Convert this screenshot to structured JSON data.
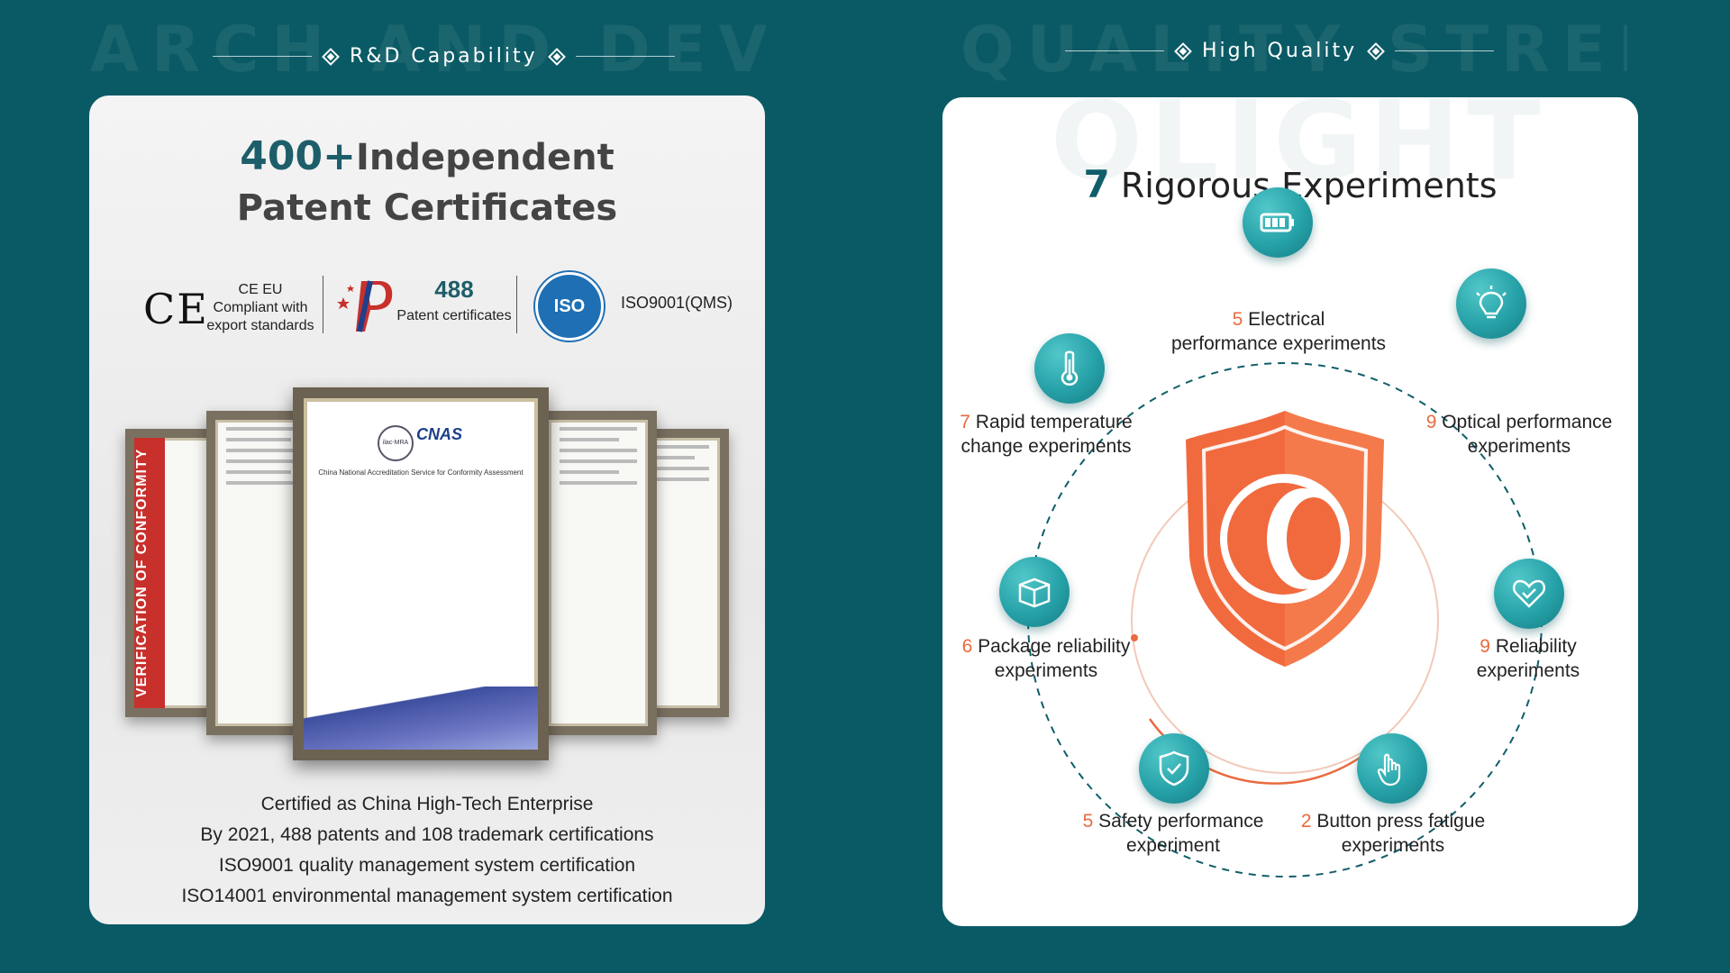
{
  "left": {
    "bg_word": "ARCH AND DEVELOPM",
    "section_title": "R&D Capability",
    "headline_num": "400+",
    "headline_1": "Independent",
    "headline_2": "Patent Certificates",
    "ce": {
      "mark": "CE",
      "line1": "CE EU",
      "line2": "Compliant with",
      "line3": "export standards"
    },
    "patent": {
      "num": "488",
      "label": "Patent certificates"
    },
    "iso": {
      "badge": "ISO",
      "label": "ISO9001(QMS)"
    },
    "voc_text": "VERIFICATION OF CONFORMITY",
    "cnas": {
      "logo": "CNAS",
      "mra": "ilac-MRA",
      "title": "China National Accreditation Service for Conformity Assessment"
    },
    "footer": [
      "Certified as  China High-Tech Enterprise",
      "By 2021, 488 patents and 108 trademark certifications",
      "ISO9001 quality management system certification",
      "ISO14001 environmental management system certification"
    ]
  },
  "right": {
    "bg_word": "QUALITY STRENGTH",
    "section_title": "High Quality",
    "watermark": "OLIGHT",
    "title_num": "7",
    "title_text": "Rigorous Experiments",
    "experiments": [
      {
        "num": "5",
        "line1": "Electrical",
        "line2": "performance experiments",
        "icon": "battery-icon"
      },
      {
        "num": "9",
        "line1": "Optical performance",
        "line2": "experiments",
        "icon": "lightbulb-icon"
      },
      {
        "num": "9",
        "line1": "Reliability",
        "line2": "experiments",
        "icon": "heart-icon"
      },
      {
        "num": "2",
        "line1": "Button press fatigue",
        "line2": "experiments",
        "icon": "finger-press-icon"
      },
      {
        "num": "5",
        "line1": "Safety performance",
        "line2": "experiment",
        "icon": "shield-check-icon"
      },
      {
        "num": "6",
        "line1": "Package reliability",
        "line2": "experiments",
        "icon": "box-icon"
      },
      {
        "num": "7",
        "line1": "Rapid temperature",
        "line2": "change experiments",
        "icon": "thermometer-icon"
      }
    ]
  },
  "colors": {
    "background": "#0a5a65",
    "accent_teal": "#25a1a7",
    "accent_orange": "#e96b3f"
  }
}
